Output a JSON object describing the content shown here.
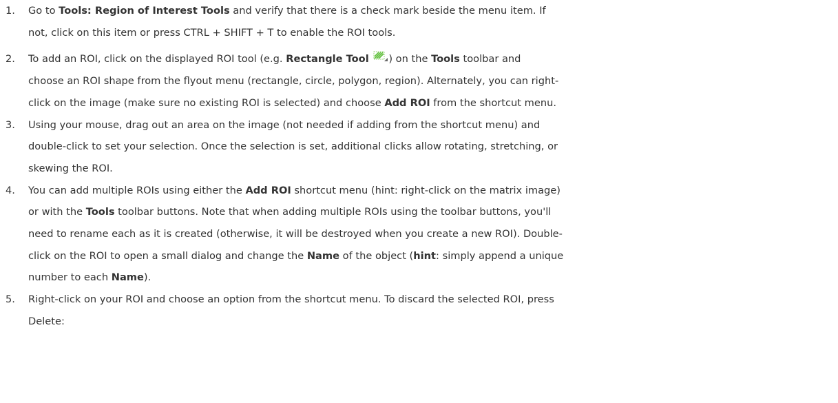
{
  "steps": [
    {
      "num": "1.",
      "t1": "Go to ",
      "b1": "Tools: Region of Interest Tools",
      "t2": " and verify that there is a check mark beside the menu item. If",
      "line2": "not, click on this item or press CTRL + SHIFT + T to enable the ROI tools."
    },
    {
      "num": "2.",
      "t1": "To add an ROI, click on the displayed ROI tool (e.g. ",
      "b1": "Rectangle Tool",
      "icon": "rectangle-tool-icon",
      "t2": ") on the ",
      "b2": "Tools",
      "t3": " toolbar and",
      "line2": "choose an ROI shape from the flyout menu (rectangle, circle, polygon, region). Alternately, you can right-",
      "line3a": "click on the image (make sure no existing ROI is selected) and choose ",
      "b3": "Add ROI",
      "line3b": " from the shortcut menu."
    },
    {
      "num": "3.",
      "line1": "Using your mouse, drag out an area on the image (not needed if adding from the shortcut menu) and",
      "line2": "double-click to set your selection. Once the selection is set, additional clicks allow rotating, stretching, or",
      "line3": "skewing the ROI."
    },
    {
      "num": "4.",
      "t1": "You can add multiple ROIs using either the ",
      "b1": "Add ROI",
      "t2": " shortcut menu (hint: right-click on the matrix image)",
      "l2a": "or with the ",
      "b2": "Tools",
      "l2b": " toolbar buttons. Note that when adding multiple ROIs using the toolbar buttons, you'll",
      "line3": "need to rename each as it is created (otherwise, it will be destroyed when you create a new ROI). Double-",
      "l4a": "click on the ROI to open a small dialog and change the ",
      "b3": "Name",
      "l4b": " of the object (",
      "b4": "hint",
      "l4c": ": simply append a unique",
      "l5a": "number to each ",
      "b5": "Name",
      "l5b": ")."
    },
    {
      "num": "5.",
      "line1": "Right-click on your ROI and choose an option from the shortcut menu. To discard the selected ROI, press",
      "line2": "Delete:"
    }
  ],
  "colors": {
    "text": "#333333",
    "icon_green": "#5fbf3a"
  }
}
